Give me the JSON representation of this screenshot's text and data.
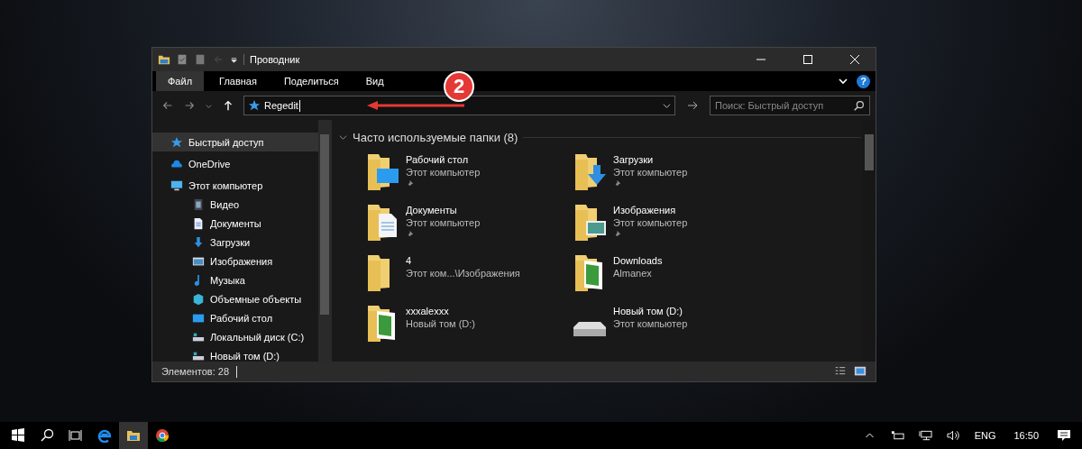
{
  "window": {
    "title": "Проводник"
  },
  "tabs": [
    {
      "label": "Файл",
      "selected": true
    },
    {
      "label": "Главная",
      "selected": false
    },
    {
      "label": "Поделиться",
      "selected": false
    },
    {
      "label": "Вид",
      "selected": false
    }
  ],
  "address": {
    "value": "Regedit"
  },
  "search": {
    "placeholder": "Поиск: Быстрый доступ"
  },
  "help": "?",
  "annotation": {
    "number": "2"
  },
  "navigation": [
    {
      "label": "Быстрый доступ",
      "kind": "star",
      "selected": true
    },
    {
      "label": "OneDrive",
      "kind": "cloud",
      "selected": false
    },
    {
      "label": "Этот компьютер",
      "kind": "pc",
      "selected": false,
      "children": [
        {
          "label": "Видео",
          "kind": "video",
          "selected": false
        },
        {
          "label": "Документы",
          "kind": "doc",
          "selected": false
        },
        {
          "label": "Загрузки",
          "kind": "down",
          "selected": false
        },
        {
          "label": "Изображения",
          "kind": "image",
          "selected": false
        },
        {
          "label": "Музыка",
          "kind": "music",
          "selected": false
        },
        {
          "label": "Объемные объекты",
          "kind": "cube",
          "selected": false
        },
        {
          "label": "Рабочий стол",
          "kind": "desktop",
          "selected": false
        },
        {
          "label": "Локальный диск (C:)",
          "kind": "drive",
          "selected": false
        },
        {
          "label": "Новый том (D:)",
          "kind": "drive",
          "selected": false
        }
      ]
    }
  ],
  "content": {
    "group_title": "Часто используемые папки (8)",
    "items": [
      {
        "name": "Рабочий стол",
        "location": "Этот компьютер",
        "pinned": true,
        "kind": "desktop"
      },
      {
        "name": "Загрузки",
        "location": "Этот компьютер",
        "pinned": true,
        "kind": "down"
      },
      {
        "name": "Документы",
        "location": "Этот компьютер",
        "pinned": true,
        "kind": "doc"
      },
      {
        "name": "Изображения",
        "location": "Этот компьютер",
        "pinned": true,
        "kind": "image"
      },
      {
        "name": "4",
        "location": "Этот ком...\\Изображения",
        "pinned": false,
        "kind": "folder"
      },
      {
        "name": "Downloads",
        "location": "Almanex",
        "pinned": false,
        "kind": "green"
      },
      {
        "name": "xxxalexxx",
        "location": "Новый том (D:)",
        "pinned": false,
        "kind": "green"
      },
      {
        "name": "Новый том (D:)",
        "location": "Этот компьютер",
        "pinned": false,
        "kind": "drive"
      }
    ]
  },
  "status_bar": {
    "count": "Элементов: 28"
  },
  "taskbar": {
    "language": "ENG",
    "time": "16:50"
  }
}
